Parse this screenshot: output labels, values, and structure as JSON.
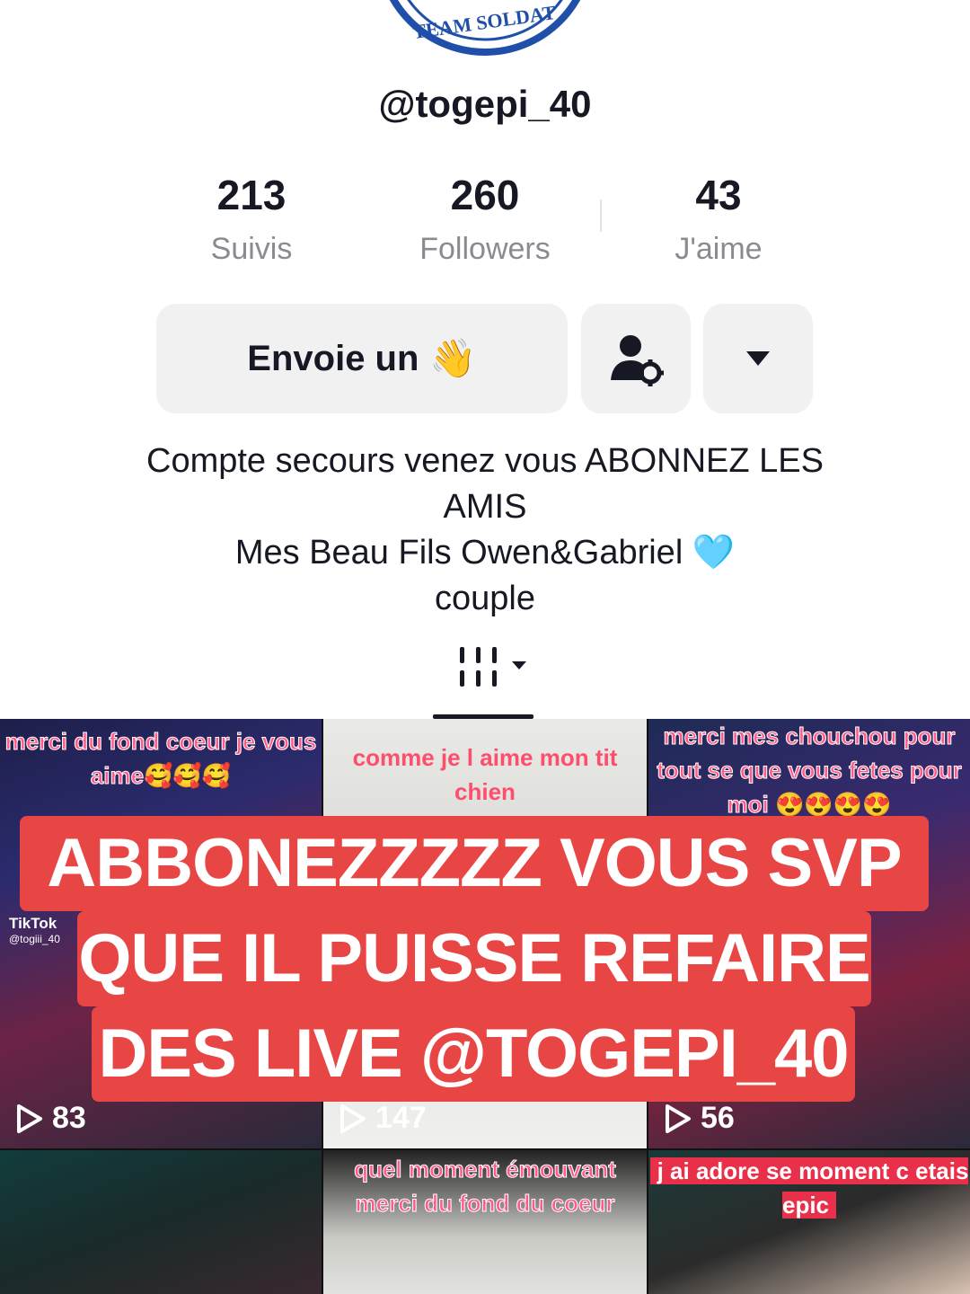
{
  "profile": {
    "avatar_text": "TEAM SOLDAT",
    "username": "@togepi_40",
    "stats": [
      {
        "value": "213",
        "label": "Suivis"
      },
      {
        "value": "260",
        "label": "Followers"
      },
      {
        "value": "43",
        "label": "J'aime"
      }
    ],
    "message_button": "Envoie un",
    "message_emoji": "👋",
    "bio_lines": [
      "Compte secours venez vous ABONNEZ LES",
      "AMIS",
      "Mes Beau Fils Owen&Gabriel",
      "couple"
    ],
    "bio_emoji": "🩵"
  },
  "videos": [
    {
      "caption": "merci du fond coeur je vous aime🥰🥰🥰",
      "views": "83",
      "watermark_app": "TikTok",
      "watermark_user": "@togiii_40"
    },
    {
      "caption": "comme je l aime mon tit chien",
      "views": "147"
    },
    {
      "caption": "merci mes chouchou pour tout se que vous fetes pour moi 😍😍😍😍",
      "views": "56"
    },
    {
      "caption": ""
    },
    {
      "caption": "quel moment émouvant merci du fond du coeur"
    },
    {
      "caption": "j ai adore se moment c etais epic"
    }
  ],
  "banner": {
    "lines": [
      "ABBONEZZZZZ VOUS SVP",
      "QUE IL PUISSE REFAIRE",
      "DES LIVE @TOGEPI_40"
    ],
    "color": "#e84545"
  },
  "icons": {
    "add_friend": "person-gear-icon",
    "more": "caret-down-icon",
    "grid_tab": "grid-icon"
  }
}
